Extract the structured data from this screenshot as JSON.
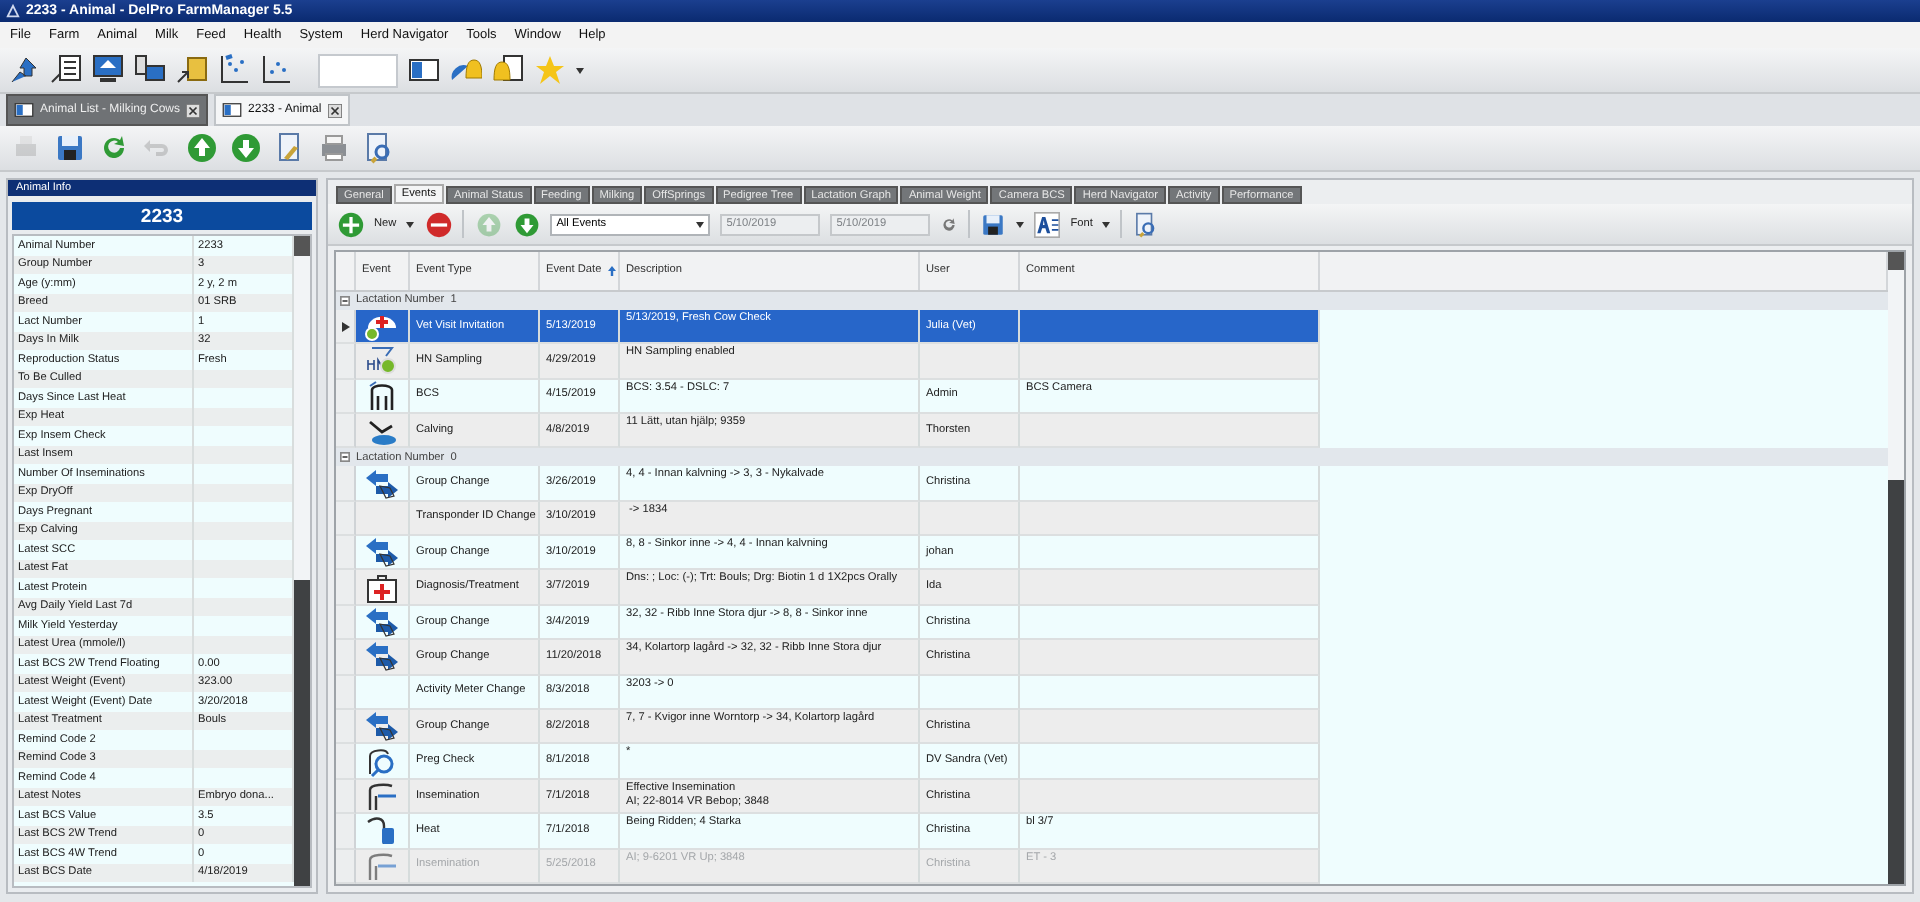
{
  "window": {
    "title": "2233  - Animal - DelPro FarmManager 5.5"
  },
  "menu": [
    "File",
    "Farm",
    "Animal",
    "Milk",
    "Feed",
    "Health",
    "System",
    "Herd Navigator",
    "Tools",
    "Window",
    "Help"
  ],
  "doc_tabs": [
    {
      "label": "Animal List - Milking Cows",
      "selected": false
    },
    {
      "label": "2233  - Animal",
      "selected": true
    }
  ],
  "action_buttons": [
    {
      "kind": "print",
      "disabled": true
    },
    {
      "kind": "save",
      "disabled": false
    },
    {
      "kind": "refresh",
      "disabled": false
    },
    {
      "kind": "undo",
      "disabled": true
    },
    {
      "kind": "up",
      "disabled": false
    },
    {
      "kind": "down",
      "disabled": false
    },
    {
      "kind": "edit",
      "disabled": false
    },
    {
      "kind": "printer",
      "disabled": false
    },
    {
      "kind": "preview",
      "disabled": false
    }
  ],
  "animal_info": {
    "header": "Animal Info",
    "number": "2233",
    "fields": [
      {
        "label": "Animal Number",
        "value": "2233"
      },
      {
        "label": "Group Number",
        "value": "3"
      },
      {
        "label": "Age (y:mm)",
        "value": "2 y, 2 m"
      },
      {
        "label": "Breed",
        "value": "01 SRB"
      },
      {
        "label": "Lact Number",
        "value": "1"
      },
      {
        "label": "Days In Milk",
        "value": "32"
      },
      {
        "label": "Reproduction Status",
        "value": "Fresh"
      },
      {
        "label": "To Be Culled"
      },
      {
        "label": "Days Since Last Heat"
      },
      {
        "label": "Exp Heat"
      },
      {
        "label": "Exp Insem Check"
      },
      {
        "label": "Last Insem"
      },
      {
        "label": "Number Of Inseminations"
      },
      {
        "label": "Exp DryOff"
      },
      {
        "label": "Days Pregnant"
      },
      {
        "label": "Exp Calving"
      },
      {
        "label": "Latest SCC"
      },
      {
        "label": "Latest Fat"
      },
      {
        "label": "Latest Protein"
      },
      {
        "label": "Avg Daily Yield Last 7d"
      },
      {
        "label": "Milk Yield Yesterday"
      },
      {
        "label": "Latest Urea (mmole/l)"
      },
      {
        "label": "Last BCS 2W Trend Floating",
        "value": "0.00"
      },
      {
        "label": "Latest Weight (Event)",
        "value": "323.00"
      },
      {
        "label": "Latest Weight (Event) Date",
        "value": "3/20/2018"
      },
      {
        "label": "Latest Treatment",
        "value": "Bouls"
      },
      {
        "label": "Remind Code 2"
      },
      {
        "label": "Remind Code 3"
      },
      {
        "label": "Remind Code 4"
      },
      {
        "label": "Latest Notes",
        "value": "Embryo dona..."
      },
      {
        "label": "Last BCS Value",
        "value": "3.5"
      },
      {
        "label": "Last BCS 2W Trend",
        "value": "0"
      },
      {
        "label": "Last BCS 4W Trend",
        "value": "0"
      },
      {
        "label": "Last BCS Date",
        "value": "4/18/2019"
      }
    ]
  },
  "tabs": [
    {
      "label": "General",
      "selected": false
    },
    {
      "label": "Events",
      "selected": true
    },
    {
      "label": "Animal Status",
      "selected": false
    },
    {
      "label": "Feeding",
      "selected": false
    },
    {
      "label": "Milking",
      "selected": false
    },
    {
      "label": "OffSprings",
      "selected": false
    },
    {
      "label": "Pedigree Tree",
      "selected": false
    },
    {
      "label": "Lactation Graph",
      "selected": false
    },
    {
      "label": "Animal Weight",
      "selected": false
    },
    {
      "label": "Camera BCS",
      "selected": false
    },
    {
      "label": "Herd Navigator",
      "selected": false
    },
    {
      "label": "Activity",
      "selected": false
    },
    {
      "label": "Performance",
      "selected": false
    }
  ],
  "events_toolbar": {
    "new_label": "New",
    "filter": "All Events",
    "date_from": {
      "value": "5/10/2019",
      "disabled": true
    },
    "date_to": {
      "value": "5/10/2019",
      "disabled": true
    },
    "font_label": "Font"
  },
  "table": {
    "columns": [
      {
        "label": "Event",
        "sorted": false
      },
      {
        "label": "Event Type",
        "sorted": false
      },
      {
        "label": "Event Date",
        "sorted": true
      },
      {
        "label": "Description",
        "sorted": false
      },
      {
        "label": "User",
        "sorted": false
      },
      {
        "label": "Comment",
        "sorted": false
      }
    ],
    "groups": [
      {
        "label": "Lactation Number  1",
        "expanded": true,
        "rows": [
          {
            "kind": "vet",
            "type": "Vet Visit Invitation",
            "date": "5/13/2019",
            "description": "5/13/2019, Fresh Cow Check",
            "user": "Julia (Vet)",
            "selected": true,
            "disabled": false
          },
          {
            "kind": "sampling",
            "type": "HN Sampling",
            "date": "4/29/2019",
            "description": "HN Sampling enabled",
            "selected": false,
            "disabled": false
          },
          {
            "kind": "bcs",
            "type": "BCS",
            "date": "4/15/2019",
            "description": "BCS: 3.54 - DSLC: 7",
            "user": "Admin",
            "comment": "BCS Camera",
            "selected": false,
            "disabled": false
          },
          {
            "kind": "calving",
            "type": "Calving",
            "date": "4/8/2019",
            "description": "11 Lätt, utan hjälp; 9359",
            "user": "Thorsten",
            "selected": false,
            "disabled": false
          }
        ]
      },
      {
        "label": "Lactation Number  0",
        "expanded": true,
        "rows": [
          {
            "kind": "group",
            "type": "Group Change",
            "date": "3/26/2019",
            "description": "4, 4 - Innan kalvning -> 3, 3 - Nykalvade",
            "user": "Christina",
            "selected": false,
            "disabled": false
          },
          {
            "kind": "none",
            "type": "Transponder ID Change",
            "date": "3/10/2019",
            "description": " -> 1834",
            "selected": false,
            "disabled": false
          },
          {
            "kind": "group",
            "type": "Group Change",
            "date": "3/10/2019",
            "description": "8, 8 - Sinkor inne -> 4, 4 - Innan kalvning",
            "user": "johan",
            "selected": false,
            "disabled": false
          },
          {
            "kind": "treatment",
            "type": "Diagnosis/Treatment",
            "date": "3/7/2019",
            "description": "Dns: ; Loc: (-); Trt: Bouls; Drg: Biotin 1 d 1X2pcs Orally",
            "user": "Ida",
            "selected": false,
            "disabled": false
          },
          {
            "kind": "group",
            "type": "Group Change",
            "date": "3/4/2019",
            "description": "32, 32 - Ribb Inne Stora djur -> 8, 8 - Sinkor inne",
            "user": "Christina",
            "selected": false,
            "disabled": false
          },
          {
            "kind": "group",
            "type": "Group Change",
            "date": "11/20/2018",
            "description": "34, Kolartorp lagård -> 32, 32 - Ribb Inne Stora djur",
            "user": "Christina",
            "selected": false,
            "disabled": false
          },
          {
            "kind": "none",
            "type": "Activity Meter Change",
            "date": "8/3/2018",
            "description": "3203 -> 0",
            "selected": false,
            "disabled": false
          },
          {
            "kind": "group",
            "type": "Group Change",
            "date": "8/2/2018",
            "description": "7, 7 - Kvigor inne Worntorp -> 34, Kolartorp lagård",
            "user": "Christina",
            "selected": false,
            "disabled": false
          },
          {
            "kind": "preg",
            "type": "Preg Check",
            "date": "8/1/2018",
            "description": "*",
            "user": "DV Sandra (Vet)",
            "selected": false,
            "disabled": false
          },
          {
            "kind": "insem",
            "type": "Insemination",
            "date": "7/1/2018",
            "description": "Effective Insemination\nAI; 22-8014 VR Bebop; 3848",
            "user": "Christina",
            "selected": false,
            "disabled": false
          },
          {
            "kind": "heat",
            "type": "Heat",
            "date": "7/1/2018",
            "description": "Being Ridden; 4 Starka",
            "user": "Christina",
            "comment": "bl 3/7",
            "selected": false,
            "disabled": false
          },
          {
            "kind": "insem",
            "type": "Insemination",
            "date": "5/25/2018",
            "description": "AI; 9-6201 VR Up; 3848",
            "user": "Christina",
            "comment": "ET - 3",
            "selected": false,
            "disabled": true
          }
        ]
      }
    ]
  }
}
